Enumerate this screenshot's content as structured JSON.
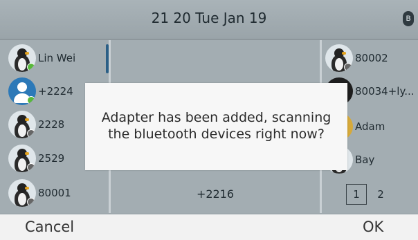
{
  "status_bar": {
    "datetime": "21 20 Tue Jan 19",
    "bluetooth_icon": "bluetooth-icon"
  },
  "left_contacts": [
    {
      "name": "Lin Wei",
      "avatar": "penguin",
      "status": "#58b83a"
    },
    {
      "name": "+2224",
      "avatar": "person",
      "status": "#58b83a"
    },
    {
      "name": "2228",
      "avatar": "penguin",
      "status": "#666666"
    },
    {
      "name": "2529",
      "avatar": "penguin",
      "status": "#666666"
    },
    {
      "name": "80001",
      "avatar": "penguin",
      "status": "#666666"
    }
  ],
  "middle": {
    "line_label": "+2216"
  },
  "right_contacts": [
    {
      "name": "80002",
      "avatar": "penguin",
      "status": "#666666"
    },
    {
      "name": "80034+ly...",
      "avatar": "dark"
    },
    {
      "name": "Adam",
      "avatar": "yellow"
    },
    {
      "name": "Bay",
      "avatar": "penguin"
    }
  ],
  "pager": {
    "current": "1",
    "next": "2"
  },
  "dialog": {
    "line1": "Adapter has been added, scanning",
    "line2": "the bluetooth devices right now?"
  },
  "softkeys": {
    "cancel": "Cancel",
    "ok": "OK"
  },
  "colors": {
    "background": "#9fa9ae",
    "accent": "#2b5f86",
    "online": "#58b83a"
  }
}
